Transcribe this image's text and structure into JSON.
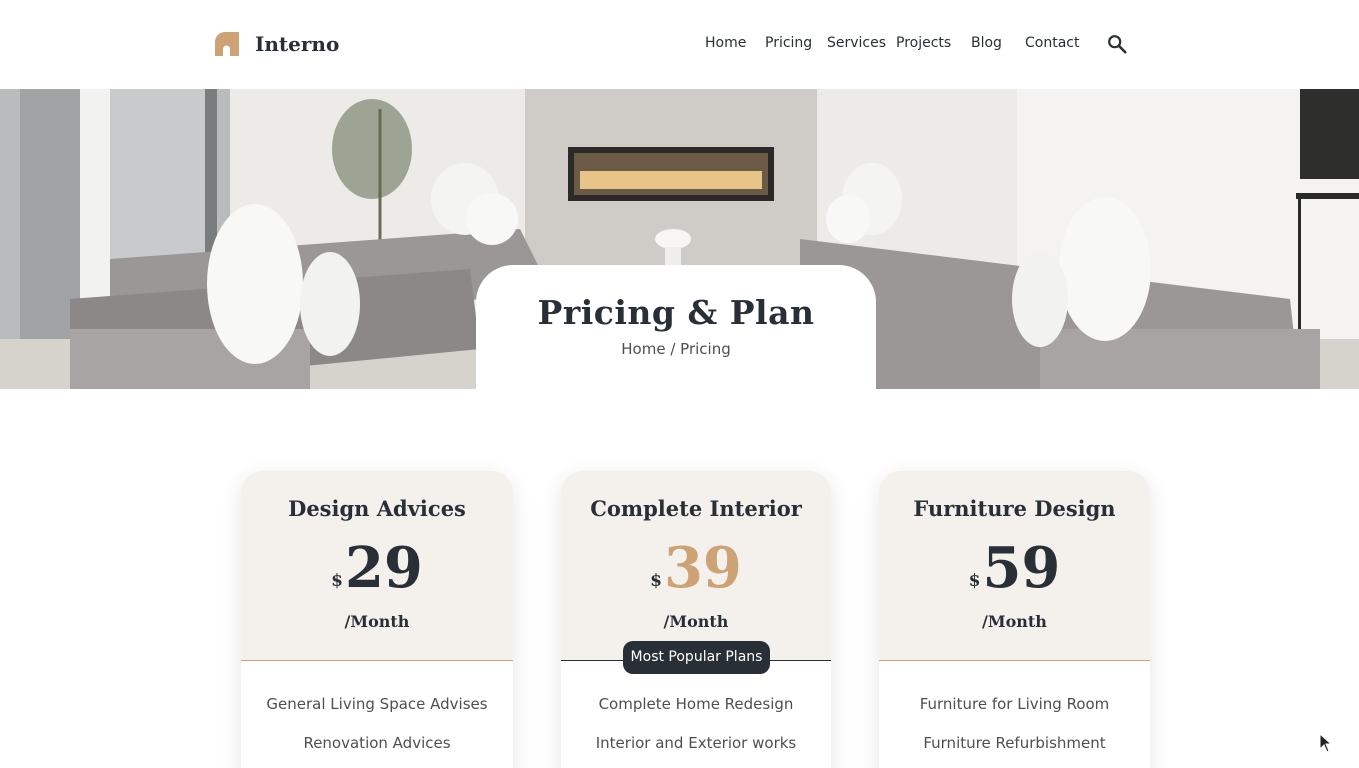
{
  "header": {
    "brand": "Interno",
    "nav": [
      "Home",
      "Pricing",
      "Services",
      "Projects",
      "Blog",
      "Contact"
    ],
    "search_icon": "search-icon"
  },
  "hero": {
    "title": "Pricing & Plan",
    "breadcrumb": {
      "home": "Home",
      "separator": "/",
      "current": "Pricing"
    }
  },
  "plans": [
    {
      "title": "Design Advices",
      "currency": "$",
      "amount": "29",
      "period": "/Month",
      "features": [
        "General Living Space Advises",
        "Renovation Advices"
      ]
    },
    {
      "title": "Complete Interior",
      "currency": "$",
      "amount": "39",
      "period": "/Month",
      "badge": "Most Popular Plans",
      "features": [
        "Complete Home Redesign",
        "Interior and Exterior works"
      ]
    },
    {
      "title": "Furniture Design",
      "currency": "$",
      "amount": "59",
      "period": "/Month",
      "features": [
        "Furniture for Living Room",
        "Furniture Refurbishment"
      ]
    }
  ],
  "colors": {
    "primary": "#292F36",
    "accent": "#CDA274",
    "card_bg": "#F4F0EC",
    "text_muted": "#4D5053"
  }
}
